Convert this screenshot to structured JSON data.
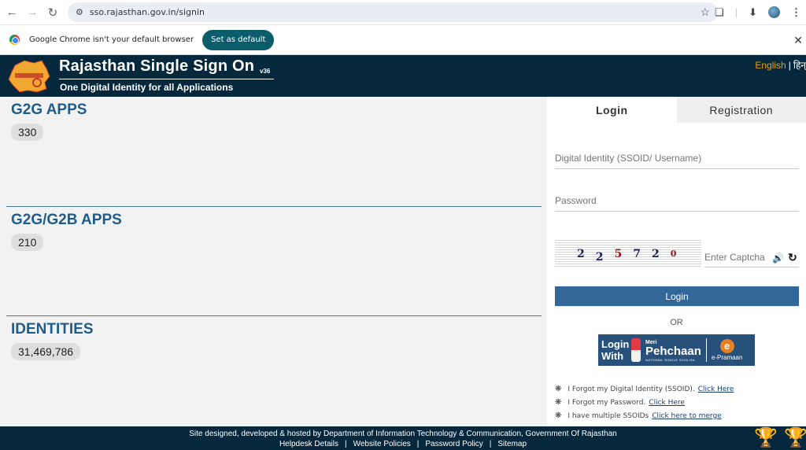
{
  "browser": {
    "url": "sso.rajasthan.gov.in/signin",
    "infobar_message": "Google Chrome isn't your default browser",
    "set_default_label": "Set as default"
  },
  "header": {
    "title": "Rajasthan Single Sign On",
    "version": "v36",
    "subtitle": "One Digital Identity for all Applications",
    "lang_english": "English",
    "lang_separator": "|",
    "lang_hindi": "हिन्"
  },
  "stats": [
    {
      "title": "G2G APPS",
      "count": "330"
    },
    {
      "title": "G2G/G2B APPS",
      "count": "210"
    },
    {
      "title": "IDENTITIES",
      "count": "31,469,786"
    }
  ],
  "login": {
    "tabs": [
      {
        "label": "Login"
      },
      {
        "label": "Registration"
      }
    ],
    "ssoid_placeholder": "Digital Identity (SSOID/ Username)",
    "password_placeholder": "Password",
    "captcha_digits": [
      "2",
      "2",
      "5",
      "7",
      "2",
      "0"
    ],
    "captcha_placeholder": "Enter Captcha",
    "login_button": "Login",
    "or_text": "OR",
    "pehchaan": {
      "login_with_1": "Login",
      "login_with_2": "With",
      "meri": "Meri",
      "name": "Pehchaan",
      "tagline": "NATIONAL SINGLE SIGN-ON",
      "epramaan": "e-Pramaan"
    },
    "links": [
      {
        "text": "I Forgot my Digital Identity (SSOID).",
        "link": "Click Here"
      },
      {
        "text": "I Forgot my Password.",
        "link": "Click Here"
      },
      {
        "text": "I have multiple SSOIDs",
        "link": "Click here to merge"
      }
    ]
  },
  "footer": {
    "line1": "Site designed, developed & hosted by Department of Information Technology & Communication, Government Of Rajasthan",
    "links": [
      "Helpdesk Details",
      "Website Policies",
      "Password Policy",
      "Sitemap"
    ],
    "separator": "|"
  }
}
